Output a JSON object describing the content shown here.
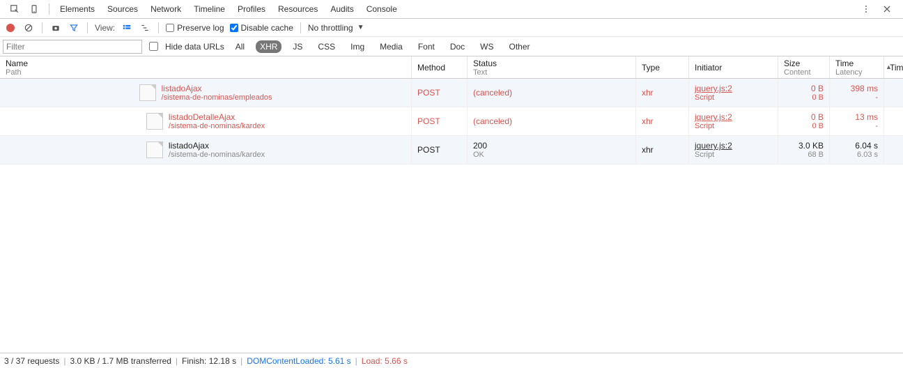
{
  "tabs": [
    "Elements",
    "Sources",
    "Network",
    "Timeline",
    "Profiles",
    "Resources",
    "Audits",
    "Console"
  ],
  "active_tab": "Network",
  "toolbar": {
    "view_label": "View:",
    "preserve_log": {
      "label": "Preserve log",
      "checked": false
    },
    "disable_cache": {
      "label": "Disable cache",
      "checked": true
    },
    "throttling": "No throttling"
  },
  "filter": {
    "placeholder": "Filter",
    "hide_data_urls": {
      "label": "Hide data URLs",
      "checked": false
    },
    "types": [
      "All",
      "XHR",
      "JS",
      "CSS",
      "Img",
      "Media",
      "Font",
      "Doc",
      "WS",
      "Other"
    ],
    "active_type": "XHR"
  },
  "headers": {
    "name": {
      "main": "Name",
      "sub": "Path"
    },
    "method": {
      "main": "Method"
    },
    "status": {
      "main": "Status",
      "sub": "Text"
    },
    "type": {
      "main": "Type"
    },
    "initiator": {
      "main": "Initiator"
    },
    "size": {
      "main": "Size",
      "sub": "Content"
    },
    "time": {
      "main": "Time",
      "sub": "Latency"
    },
    "timeline": {
      "main": "Tim"
    }
  },
  "rows": [
    {
      "failed": true,
      "name": "listadoAjax",
      "path": "/sistema-de-nominas/empleados",
      "method": "POST",
      "status_main": "(canceled)",
      "status_sub": "",
      "type": "xhr",
      "initiator_main": "jquery.js:2",
      "initiator_sub": "Script",
      "size_main": "0 B",
      "size_sub": "0 B",
      "time_main": "398 ms",
      "time_sub": "-"
    },
    {
      "failed": true,
      "name": "listadoDetalleAjax",
      "path": "/sistema-de-nominas/kardex",
      "method": "POST",
      "status_main": "(canceled)",
      "status_sub": "",
      "type": "xhr",
      "initiator_main": "jquery.js:2",
      "initiator_sub": "Script",
      "size_main": "0 B",
      "size_sub": "0 B",
      "time_main": "13 ms",
      "time_sub": "-"
    },
    {
      "failed": false,
      "name": "listadoAjax",
      "path": "/sistema-de-nominas/kardex",
      "method": "POST",
      "status_main": "200",
      "status_sub": "OK",
      "type": "xhr",
      "initiator_main": "jquery.js:2",
      "initiator_sub": "Script",
      "size_main": "3.0 KB",
      "size_sub": "68 B",
      "time_main": "6.04 s",
      "time_sub": "6.03 s"
    }
  ],
  "status": {
    "requests": "3 / 37 requests",
    "transferred": "3.0 KB / 1.7 MB transferred",
    "finish": "Finish: 12.18 s",
    "dcl": "DOMContentLoaded: 5.61 s",
    "load": "Load: 5.66 s"
  }
}
